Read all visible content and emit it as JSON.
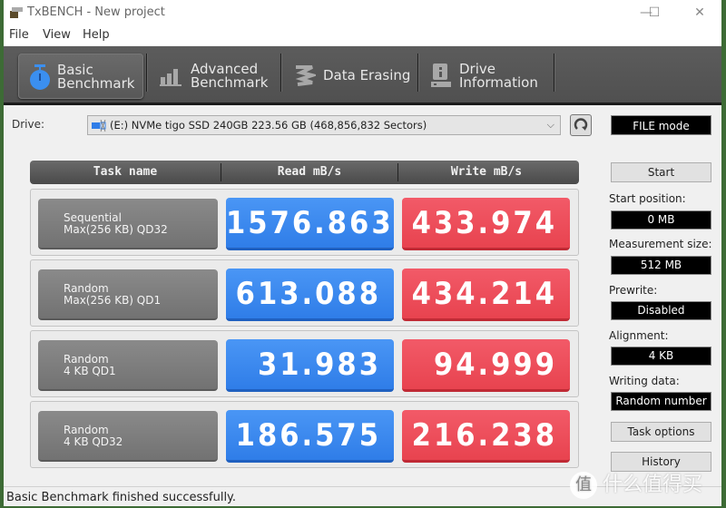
{
  "window": {
    "title": "TxBENCH - New project",
    "controls": {
      "minimize": "—",
      "maximize": "☐",
      "close": "✕"
    }
  },
  "menu": [
    "File",
    "View",
    "Help"
  ],
  "toolbar": {
    "tabs": [
      {
        "label": "Basic\nBenchmark",
        "icon": "stopwatch-icon",
        "active": true
      },
      {
        "label": "Advanced\nBenchmark",
        "icon": "bar-chart-icon",
        "active": false
      },
      {
        "label": "Data Erasing",
        "icon": "eraser-icon",
        "active": false
      },
      {
        "label": "Drive\nInformation",
        "icon": "drive-info-icon",
        "active": false
      }
    ]
  },
  "drive": {
    "label": "Drive:",
    "selected": "(E:) NVMe tigo SSD 240GB  223.56 GB (468,856,832 Sectors)",
    "mode": "FILE mode"
  },
  "table": {
    "headers": [
      "Task name",
      "Read mB/s",
      "Write mB/s"
    ],
    "rows": [
      {
        "task_line1": "Sequential",
        "task_line2": "Max(256 KB) QD32",
        "read": "1576.863",
        "write": "433.974"
      },
      {
        "task_line1": "Random",
        "task_line2": "Max(256 KB) QD1",
        "read": "613.088",
        "write": "434.214"
      },
      {
        "task_line1": "Random",
        "task_line2": "4 KB QD1",
        "read": "31.983",
        "write": "94.999"
      },
      {
        "task_line1": "Random",
        "task_line2": "4 KB QD32",
        "read": "186.575",
        "write": "216.238"
      }
    ]
  },
  "sidebar": {
    "start_label": "Start",
    "fields": [
      {
        "label": "Start position:",
        "value": "0 MB"
      },
      {
        "label": "Measurement size:",
        "value": "512 MB"
      },
      {
        "label": "Prewrite:",
        "value": "Disabled"
      },
      {
        "label": "Alignment:",
        "value": "4 KB"
      },
      {
        "label": "Writing data:",
        "value": "Random number"
      }
    ],
    "task_options_label": "Task options",
    "history_label": "History"
  },
  "status": "Basic Benchmark finished successfully.",
  "watermark": {
    "badge": "值",
    "text": "什么值得买"
  },
  "colors": {
    "read": "#2f7de8",
    "write": "#e8434f",
    "active_tab_icon": "#3b8ff0"
  }
}
